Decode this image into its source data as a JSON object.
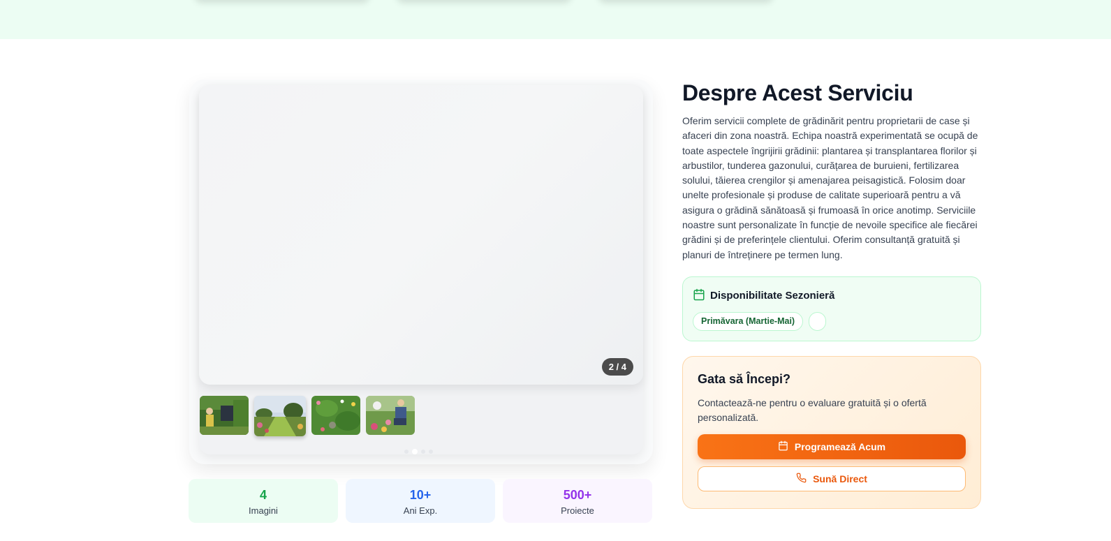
{
  "gallery": {
    "counter": "2 / 4",
    "thumbnails": [
      "garden-worker-photo",
      "garden-path-photo",
      "flower-garden-photo",
      "gardener-kneeling-photo"
    ],
    "active_index": 1
  },
  "stats": [
    {
      "value": "4",
      "label": "Imagini",
      "color": "#16a34a"
    },
    {
      "value": "10+",
      "label": "Ani Exp.",
      "color": "#2563eb"
    },
    {
      "value": "500+",
      "label": "Proiecte",
      "color": "#9333ea"
    }
  ],
  "about": {
    "title": "Despre Acest Serviciu",
    "description": "Oferim servicii complete de grădinărit pentru proprietarii de case și afaceri din zona noastră. Echipa noastră experimentată se ocupă de toate aspectele îngrijirii grădinii: plantarea și transplantarea florilor și arbustilor, tunderea gazonului, curățarea de buruieni, fertilizarea solului, tăierea crengilor și amenajarea peisagistică. Folosim doar unelte profesionale și produse de calitate superioară pentru a vă asigura o grădină sănătoasă și frumoasă în orice anotimp. Serviciile noastre sunt personalizate în funcție de nevoile specifice ale fiecărei grădini și de preferințele clientului. Oferim consultanță gratuită și planuri de întreținere pe termen lung."
  },
  "seasonal": {
    "title": "Disponibilitate Sezonieră",
    "tags": [
      "Primăvara (Martie-Mai)",
      ""
    ]
  },
  "cta": {
    "title": "Gata să Începi?",
    "text": "Contactează-ne pentru o evaluare gratuită și o ofertă personalizată.",
    "primary_label": "Programează Acum",
    "secondary_label": "Sună Direct"
  },
  "colors": {
    "accent_green": "#16a34a",
    "accent_orange": "#ea580c"
  }
}
